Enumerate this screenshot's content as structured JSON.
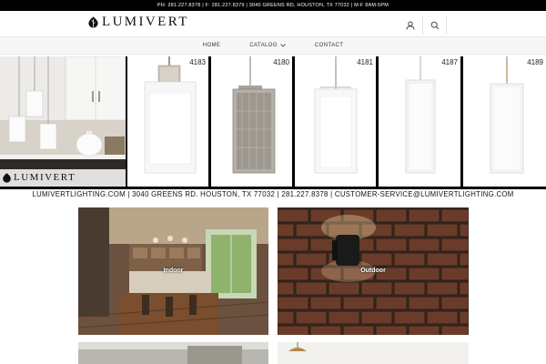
{
  "topbar": {
    "text": "PH: 281.227.8378 | F: 281.227.8379 | 3040 GREENS RD, HOUSTON, TX 77032 | M-F 8AM-5PM"
  },
  "header": {
    "logo_text": "LUMIVERT",
    "icons": [
      "user-icon",
      "search-icon"
    ]
  },
  "nav": {
    "items": [
      {
        "label": "HOME"
      },
      {
        "label": "CATALOG"
      },
      {
        "label": "CONTACT"
      }
    ]
  },
  "banner": {
    "logo_text": "LUMIVERT",
    "products": [
      {
        "number": "4183"
      },
      {
        "number": "4180"
      },
      {
        "number": "4181"
      },
      {
        "number": "4187"
      },
      {
        "number": "4189"
      }
    ],
    "caption": "LUMIVERTLIGHTING.COM | 3040 GREENS RD. HOUSTON, TX 77032 | 281.227.8378 | CUSTOMER-SERVICE@LUMIVERTLIGHTING.COM"
  },
  "categories": [
    {
      "label": "Indoor"
    },
    {
      "label": "Outdoor"
    }
  ],
  "colors": {
    "topbar": "#000000",
    "nav_bg": "#f7f7f7",
    "banner_frame": "#000000"
  }
}
